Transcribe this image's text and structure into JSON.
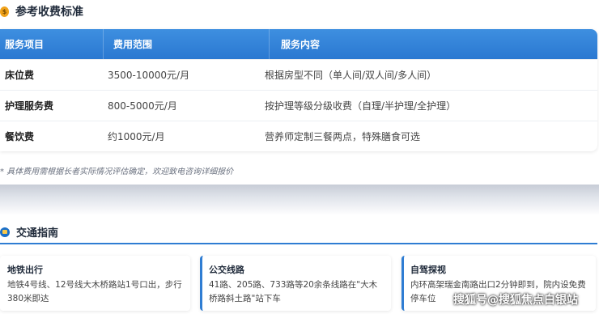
{
  "fees": {
    "title": "参考收费标准",
    "headers": [
      "服务项目",
      "费用范围",
      "服务内容"
    ],
    "rows": [
      {
        "item": "床位费",
        "range": "3500-10000元/月",
        "desc": "根据房型不同（单人间/双人间/多人间）"
      },
      {
        "item": "护理服务费",
        "range": "800-5000元/月",
        "desc": "按护理等级分级收费（自理/半护理/全护理）"
      },
      {
        "item": "餐饮费",
        "range": "约1000元/月",
        "desc": "营养师定制三餐两点，特殊膳食可选"
      }
    ],
    "note": "* 具体费用需根据长者实际情况评估确定，欢迎致电咨询详细报价"
  },
  "transport": {
    "title": "交通指南",
    "cards": [
      {
        "title": "地铁出行",
        "text": "地铁4号线、12号线大木桥路站1号口出，步行380米即达"
      },
      {
        "title": "公交线路",
        "text": "41路、205路、733路等20余条线路在\"大木桥路斜土路\"站下车"
      },
      {
        "title": "自驾探视",
        "text": "内环高架瑞金南路出口2分钟即到，院内设免费停车位"
      }
    ]
  },
  "watermark": "搜狐号@搜狐焦点白银站",
  "icons": {
    "fees": "money-bag-icon",
    "transport": "bus-icon"
  },
  "colors": {
    "header": "#2a78d1",
    "accent": "#2f7dd3"
  }
}
